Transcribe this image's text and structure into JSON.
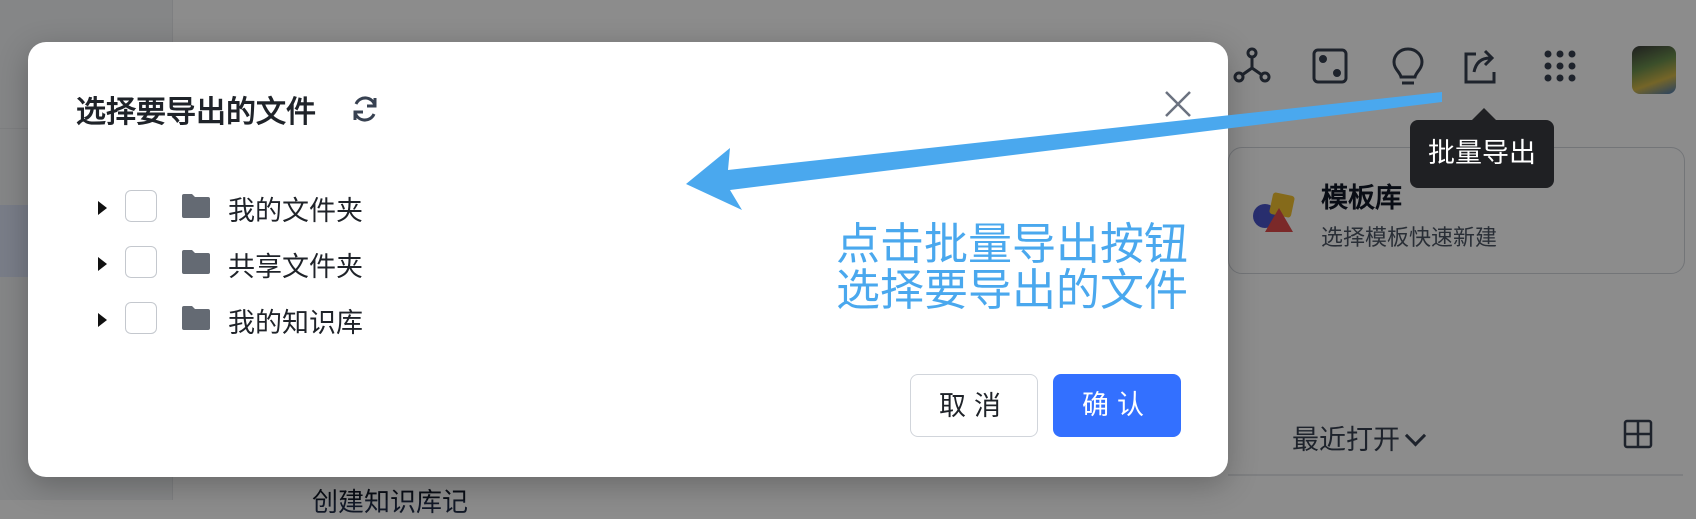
{
  "toolbar": {
    "icons": [
      "graph-icon",
      "dice-icon",
      "lightbulb-icon",
      "share-export-icon",
      "apps-grid-icon"
    ],
    "tooltip": "批量导出"
  },
  "template_card": {
    "title": "模板库",
    "subtitle": "选择模板快速新建"
  },
  "recent": {
    "label": "最近打开"
  },
  "background_text": "创建知识库记",
  "modal": {
    "title": "选择要导出的文件",
    "tree": [
      {
        "label": "我的文件夹"
      },
      {
        "label": "共享文件夹"
      },
      {
        "label": "我的知识库"
      }
    ],
    "cancel_label": "取消",
    "confirm_label": "确认"
  },
  "annotation": {
    "line1": "点击批量导出按钮",
    "line2": "选择要导出的文件"
  },
  "colors": {
    "primary": "#3370ff",
    "annotation": "#4aa8ee",
    "tooltip_bg": "#1f2023",
    "folder": "#646a73"
  }
}
